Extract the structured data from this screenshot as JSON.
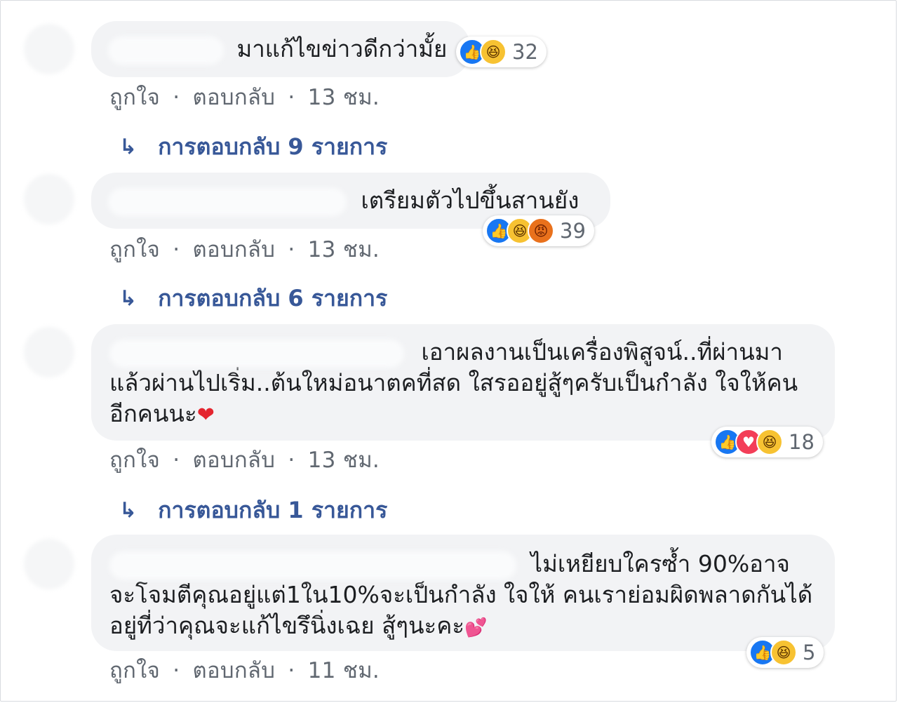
{
  "comments": [
    {
      "text": "มาแก้ไขข่าวดีกว่ามั้ย",
      "reactions": {
        "icons": [
          "like-icon",
          "haha-icon"
        ],
        "count": "32"
      },
      "meta": {
        "like": "ถูกใจ",
        "reply": "ตอบกลับ",
        "sep": "·",
        "time": "13 ชม."
      },
      "replies": "การตอบกลับ 9 รายการ"
    },
    {
      "text": "เตรียมตัวไปขึ้นสานยัง",
      "reactions": {
        "icons": [
          "like-icon",
          "haha-icon",
          "angry-icon"
        ],
        "count": "39"
      },
      "meta": {
        "like": "ถูกใจ",
        "reply": "ตอบกลับ",
        "sep": "·",
        "time": "13 ชม."
      },
      "replies": "การตอบกลับ 6 รายการ"
    },
    {
      "text": "เอาผลงานเป็นเครื่องพิสูจน์..ที่ผ่านมาแล้วผ่านไปเริ่ม..ต้นใหม่อนาตคที่สด ใสรออยู่สู้ๆครับเป็นกำลัง ใจให้คนอีกคนนะ",
      "emoji": "❤",
      "reactions": {
        "icons": [
          "like-icon",
          "love-icon",
          "haha-icon"
        ],
        "count": "18"
      },
      "meta": {
        "like": "ถูกใจ",
        "reply": "ตอบกลับ",
        "sep": "·",
        "time": "13 ชม."
      },
      "replies": "การตอบกลับ 1 รายการ"
    },
    {
      "text": "ไม่เหยียบใครซ้ำ 90%อาจจะโจมตีคุณอยู่แต่1ใน10%จะเป็นกำลัง ใจให้ คนเราย่อมผิดพลาดกันได้อยู่ที่ว่าคุณจะแก้ไขรึนิ่งเฉย สู้ๆนะคะ",
      "emoji": "💕",
      "reactions": {
        "icons": [
          "like-icon",
          "haha-icon"
        ],
        "count": "5"
      },
      "meta": {
        "like": "ถูกใจ",
        "reply": "ตอบกลับ",
        "sep": "·",
        "time": "11 ชม."
      }
    }
  ],
  "reply_arrow": "↳",
  "colors": {
    "link": "#385898",
    "meta": "#606770",
    "bubble": "#f2f3f5"
  }
}
